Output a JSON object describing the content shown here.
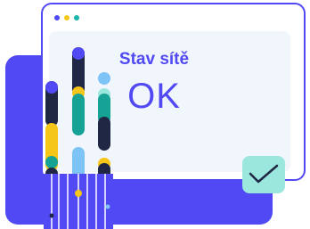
{
  "status": {
    "label": "Stav sítě",
    "value": "OK"
  },
  "window": {
    "titlebar_dots": [
      "dot",
      "dot",
      "dot"
    ]
  },
  "icons": {
    "check": "check-icon"
  },
  "colors": {
    "primary": "#5149f3",
    "dot1": "#5149f3",
    "dot2": "#f5c518",
    "dot3": "#18b5a8",
    "teal": "#16a294",
    "yellow": "#f5c518",
    "light_blue": "#7dc3f5",
    "navy": "#1f2744",
    "mint": "#9be6dd"
  }
}
